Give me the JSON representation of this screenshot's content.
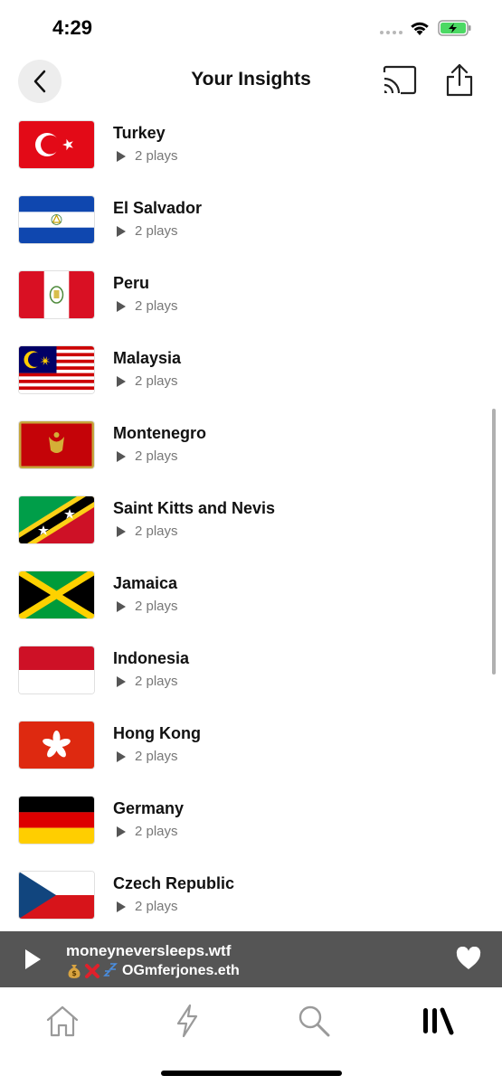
{
  "status_bar": {
    "time": "4:29"
  },
  "header": {
    "title": "Your Insights"
  },
  "countries": [
    {
      "name": "Turkey",
      "plays": "2 plays"
    },
    {
      "name": "El Salvador",
      "plays": "2 plays"
    },
    {
      "name": "Peru",
      "plays": "2 plays"
    },
    {
      "name": "Malaysia",
      "plays": "2 plays"
    },
    {
      "name": "Montenegro",
      "plays": "2 plays"
    },
    {
      "name": "Saint Kitts and Nevis",
      "plays": "2 plays"
    },
    {
      "name": "Jamaica",
      "plays": "2 plays"
    },
    {
      "name": "Indonesia",
      "plays": "2 plays"
    },
    {
      "name": "Hong Kong",
      "plays": "2 plays"
    },
    {
      "name": "Germany",
      "plays": "2 plays"
    },
    {
      "name": "Czech Republic",
      "plays": "2 plays"
    }
  ],
  "mini_player": {
    "title": "moneyneversleeps.wtf",
    "artist": "OGmferjones.eth",
    "liked": true
  },
  "tabs": [
    {
      "name": "home",
      "icon": "home-icon",
      "active": false
    },
    {
      "name": "activity",
      "icon": "lightning-icon",
      "active": false
    },
    {
      "name": "search",
      "icon": "search-icon",
      "active": false
    },
    {
      "name": "library",
      "icon": "library-icon",
      "active": true
    }
  ],
  "colors": {
    "accent": "#000000",
    "mini_player_bg": "#555555",
    "inactive_tab": "#9a9a9a"
  }
}
